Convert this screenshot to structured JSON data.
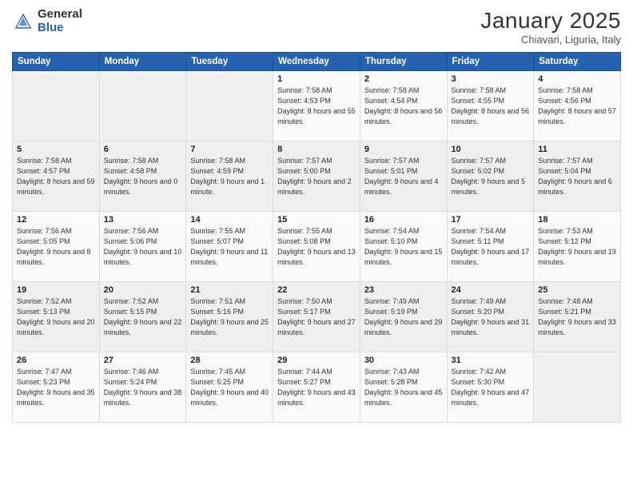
{
  "logo": {
    "general": "General",
    "blue": "Blue"
  },
  "title": "January 2025",
  "subtitle": "Chiavari, Liguria, Italy",
  "days_header": [
    "Sunday",
    "Monday",
    "Tuesday",
    "Wednesday",
    "Thursday",
    "Friday",
    "Saturday"
  ],
  "weeks": [
    [
      {
        "day": "",
        "sunrise": "",
        "sunset": "",
        "daylight": ""
      },
      {
        "day": "",
        "sunrise": "",
        "sunset": "",
        "daylight": ""
      },
      {
        "day": "",
        "sunrise": "",
        "sunset": "",
        "daylight": ""
      },
      {
        "day": "1",
        "sunrise": "Sunrise: 7:58 AM",
        "sunset": "Sunset: 4:53 PM",
        "daylight": "Daylight: 8 hours and 55 minutes."
      },
      {
        "day": "2",
        "sunrise": "Sunrise: 7:58 AM",
        "sunset": "Sunset: 4:54 PM",
        "daylight": "Daylight: 8 hours and 56 minutes."
      },
      {
        "day": "3",
        "sunrise": "Sunrise: 7:58 AM",
        "sunset": "Sunset: 4:55 PM",
        "daylight": "Daylight: 8 hours and 56 minutes."
      },
      {
        "day": "4",
        "sunrise": "Sunrise: 7:58 AM",
        "sunset": "Sunset: 4:56 PM",
        "daylight": "Daylight: 8 hours and 57 minutes."
      }
    ],
    [
      {
        "day": "5",
        "sunrise": "Sunrise: 7:58 AM",
        "sunset": "Sunset: 4:57 PM",
        "daylight": "Daylight: 8 hours and 59 minutes."
      },
      {
        "day": "6",
        "sunrise": "Sunrise: 7:58 AM",
        "sunset": "Sunset: 4:58 PM",
        "daylight": "Daylight: 9 hours and 0 minutes."
      },
      {
        "day": "7",
        "sunrise": "Sunrise: 7:58 AM",
        "sunset": "Sunset: 4:59 PM",
        "daylight": "Daylight: 9 hours and 1 minute."
      },
      {
        "day": "8",
        "sunrise": "Sunrise: 7:57 AM",
        "sunset": "Sunset: 5:00 PM",
        "daylight": "Daylight: 9 hours and 2 minutes."
      },
      {
        "day": "9",
        "sunrise": "Sunrise: 7:57 AM",
        "sunset": "Sunset: 5:01 PM",
        "daylight": "Daylight: 9 hours and 4 minutes."
      },
      {
        "day": "10",
        "sunrise": "Sunrise: 7:57 AM",
        "sunset": "Sunset: 5:02 PM",
        "daylight": "Daylight: 9 hours and 5 minutes."
      },
      {
        "day": "11",
        "sunrise": "Sunrise: 7:57 AM",
        "sunset": "Sunset: 5:04 PM",
        "daylight": "Daylight: 9 hours and 6 minutes."
      }
    ],
    [
      {
        "day": "12",
        "sunrise": "Sunrise: 7:56 AM",
        "sunset": "Sunset: 5:05 PM",
        "daylight": "Daylight: 9 hours and 8 minutes."
      },
      {
        "day": "13",
        "sunrise": "Sunrise: 7:56 AM",
        "sunset": "Sunset: 5:06 PM",
        "daylight": "Daylight: 9 hours and 10 minutes."
      },
      {
        "day": "14",
        "sunrise": "Sunrise: 7:55 AM",
        "sunset": "Sunset: 5:07 PM",
        "daylight": "Daylight: 9 hours and 11 minutes."
      },
      {
        "day": "15",
        "sunrise": "Sunrise: 7:55 AM",
        "sunset": "Sunset: 5:08 PM",
        "daylight": "Daylight: 9 hours and 13 minutes."
      },
      {
        "day": "16",
        "sunrise": "Sunrise: 7:54 AM",
        "sunset": "Sunset: 5:10 PM",
        "daylight": "Daylight: 9 hours and 15 minutes."
      },
      {
        "day": "17",
        "sunrise": "Sunrise: 7:54 AM",
        "sunset": "Sunset: 5:11 PM",
        "daylight": "Daylight: 9 hours and 17 minutes."
      },
      {
        "day": "18",
        "sunrise": "Sunrise: 7:53 AM",
        "sunset": "Sunset: 5:12 PM",
        "daylight": "Daylight: 9 hours and 19 minutes."
      }
    ],
    [
      {
        "day": "19",
        "sunrise": "Sunrise: 7:52 AM",
        "sunset": "Sunset: 5:13 PM",
        "daylight": "Daylight: 9 hours and 20 minutes."
      },
      {
        "day": "20",
        "sunrise": "Sunrise: 7:52 AM",
        "sunset": "Sunset: 5:15 PM",
        "daylight": "Daylight: 9 hours and 22 minutes."
      },
      {
        "day": "21",
        "sunrise": "Sunrise: 7:51 AM",
        "sunset": "Sunset: 5:16 PM",
        "daylight": "Daylight: 9 hours and 25 minutes."
      },
      {
        "day": "22",
        "sunrise": "Sunrise: 7:50 AM",
        "sunset": "Sunset: 5:17 PM",
        "daylight": "Daylight: 9 hours and 27 minutes."
      },
      {
        "day": "23",
        "sunrise": "Sunrise: 7:49 AM",
        "sunset": "Sunset: 5:19 PM",
        "daylight": "Daylight: 9 hours and 29 minutes."
      },
      {
        "day": "24",
        "sunrise": "Sunrise: 7:49 AM",
        "sunset": "Sunset: 5:20 PM",
        "daylight": "Daylight: 9 hours and 31 minutes."
      },
      {
        "day": "25",
        "sunrise": "Sunrise: 7:48 AM",
        "sunset": "Sunset: 5:21 PM",
        "daylight": "Daylight: 9 hours and 33 minutes."
      }
    ],
    [
      {
        "day": "26",
        "sunrise": "Sunrise: 7:47 AM",
        "sunset": "Sunset: 5:23 PM",
        "daylight": "Daylight: 9 hours and 35 minutes."
      },
      {
        "day": "27",
        "sunrise": "Sunrise: 7:46 AM",
        "sunset": "Sunset: 5:24 PM",
        "daylight": "Daylight: 9 hours and 38 minutes."
      },
      {
        "day": "28",
        "sunrise": "Sunrise: 7:45 AM",
        "sunset": "Sunset: 5:25 PM",
        "daylight": "Daylight: 9 hours and 40 minutes."
      },
      {
        "day": "29",
        "sunrise": "Sunrise: 7:44 AM",
        "sunset": "Sunset: 5:27 PM",
        "daylight": "Daylight: 9 hours and 43 minutes."
      },
      {
        "day": "30",
        "sunrise": "Sunrise: 7:43 AM",
        "sunset": "Sunset: 5:28 PM",
        "daylight": "Daylight: 9 hours and 45 minutes."
      },
      {
        "day": "31",
        "sunrise": "Sunrise: 7:42 AM",
        "sunset": "Sunset: 5:30 PM",
        "daylight": "Daylight: 9 hours and 47 minutes."
      },
      {
        "day": "",
        "sunrise": "",
        "sunset": "",
        "daylight": ""
      }
    ]
  ]
}
